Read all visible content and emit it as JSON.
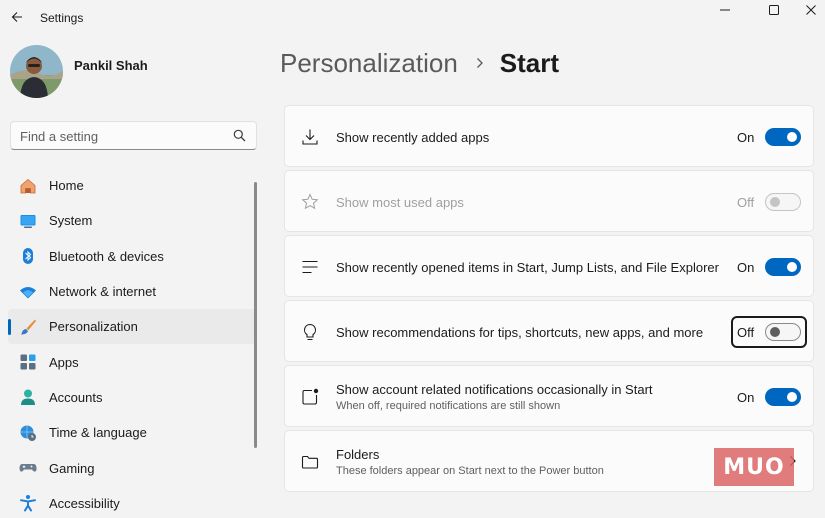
{
  "window": {
    "title": "Settings"
  },
  "profile": {
    "name": "Pankil Shah"
  },
  "search": {
    "placeholder": "Find a setting"
  },
  "nav": {
    "items": [
      {
        "label": "Home",
        "icon": "home-icon",
        "selected": false
      },
      {
        "label": "System",
        "icon": "system-icon",
        "selected": false
      },
      {
        "label": "Bluetooth & devices",
        "icon": "bluetooth-icon",
        "selected": false
      },
      {
        "label": "Network & internet",
        "icon": "wifi-icon",
        "selected": false
      },
      {
        "label": "Personalization",
        "icon": "brush-icon",
        "selected": true
      },
      {
        "label": "Apps",
        "icon": "apps-icon",
        "selected": false
      },
      {
        "label": "Accounts",
        "icon": "accounts-icon",
        "selected": false
      },
      {
        "label": "Time & language",
        "icon": "globe-clock-icon",
        "selected": false
      },
      {
        "label": "Gaming",
        "icon": "gamepad-icon",
        "selected": false
      },
      {
        "label": "Accessibility",
        "icon": "accessibility-icon",
        "selected": false
      }
    ]
  },
  "header": {
    "parent": "Personalization",
    "current": "Start"
  },
  "settings": [
    {
      "title": "Show recently added apps",
      "subtitle": "",
      "state": "On",
      "toggle": true,
      "disabled": false,
      "icon": "download-icon"
    },
    {
      "title": "Show most used apps",
      "subtitle": "",
      "state": "Off",
      "toggle": false,
      "disabled": true,
      "icon": "star-icon"
    },
    {
      "title": "Show recently opened items in Start, Jump Lists, and File Explorer",
      "subtitle": "",
      "state": "On",
      "toggle": true,
      "disabled": false,
      "icon": "list-icon"
    },
    {
      "title": "Show recommendations for tips, shortcuts, new apps, and more",
      "subtitle": "",
      "state": "Off",
      "toggle": false,
      "disabled": false,
      "focused": true,
      "icon": "lightbulb-icon"
    },
    {
      "title": "Show account related notifications occasionally in Start",
      "subtitle": "When off, required notifications are still shown",
      "state": "On",
      "toggle": true,
      "disabled": false,
      "icon": "notification-badge-icon"
    },
    {
      "title": "Folders",
      "subtitle": "These folders appear on Start next to the Power button",
      "state": "",
      "toggle": null,
      "disabled": false,
      "icon": "folder-icon"
    }
  ],
  "watermark": {
    "text": "MUO"
  },
  "colors": {
    "accent": "#0067c0",
    "background": "#f3f3f3",
    "card": "#fbfbfb"
  }
}
